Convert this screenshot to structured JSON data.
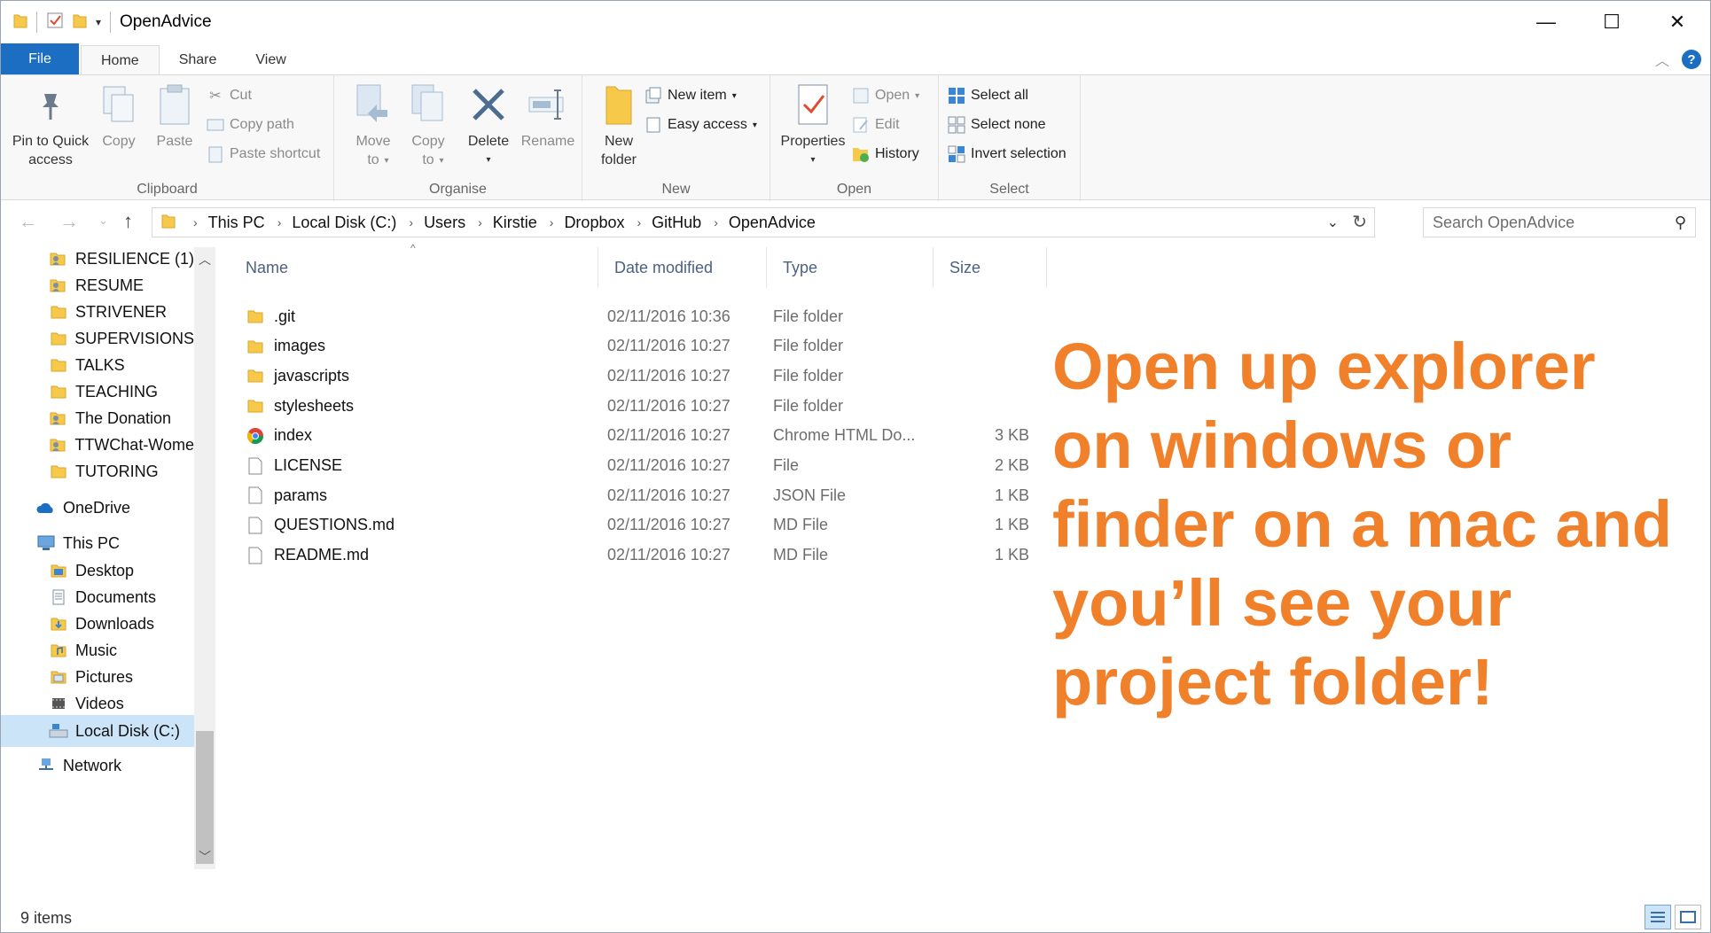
{
  "window": {
    "title": "OpenAdvice",
    "minimize": "—",
    "maximize": "☐",
    "close": "✕"
  },
  "tabs": [
    {
      "label": "File"
    },
    {
      "label": "Home"
    },
    {
      "label": "Share"
    },
    {
      "label": "View"
    }
  ],
  "ribbon": {
    "clipboard": {
      "label": "Clipboard",
      "pin": "Pin to Quick access",
      "copy": "Copy",
      "paste": "Paste",
      "cut": "Cut",
      "copy_path": "Copy path",
      "paste_shortcut": "Paste shortcut"
    },
    "organise": {
      "label": "Organise",
      "move_to": "Move to",
      "copy_to": "Copy to",
      "delete": "Delete",
      "rename": "Rename"
    },
    "new": {
      "label": "New",
      "new_folder": "New folder",
      "new_item": "New item",
      "easy_access": "Easy access"
    },
    "open": {
      "label": "Open",
      "properties": "Properties",
      "open": "Open",
      "edit": "Edit",
      "history": "History"
    },
    "select": {
      "label": "Select",
      "select_all": "Select all",
      "select_none": "Select none",
      "invert_selection": "Invert selection"
    }
  },
  "address": {
    "crumbs": [
      "This PC",
      "Local Disk (C:)",
      "Users",
      "Kirstie",
      "Dropbox",
      "GitHub",
      "OpenAdvice"
    ]
  },
  "search": {
    "placeholder": "Search OpenAdvice"
  },
  "nav_pane": {
    "items": [
      {
        "label": "RESILIENCE (1)",
        "icon": "shared-folder-icon"
      },
      {
        "label": "RESUME",
        "icon": "shared-folder-icon"
      },
      {
        "label": "STRIVENER",
        "icon": "folder-icon"
      },
      {
        "label": "SUPERVISIONS",
        "icon": "folder-icon"
      },
      {
        "label": "TALKS",
        "icon": "folder-icon"
      },
      {
        "label": "TEACHING",
        "icon": "folder-icon"
      },
      {
        "label": "The Donation",
        "icon": "shared-folder-icon"
      },
      {
        "label": "TTWChat-Wome",
        "icon": "shared-folder-icon"
      },
      {
        "label": "TUTORING",
        "icon": "folder-icon"
      },
      {
        "label": "OneDrive",
        "icon": "onedrive-icon"
      },
      {
        "label": "This PC",
        "icon": "this-pc-icon"
      },
      {
        "label": "Desktop",
        "icon": "desktop-folder-icon"
      },
      {
        "label": "Documents",
        "icon": "documents-folder-icon"
      },
      {
        "label": "Downloads",
        "icon": "downloads-folder-icon"
      },
      {
        "label": "Music",
        "icon": "music-folder-icon"
      },
      {
        "label": "Pictures",
        "icon": "pictures-folder-icon"
      },
      {
        "label": "Videos",
        "icon": "videos-folder-icon"
      },
      {
        "label": "Local Disk (C:)",
        "icon": "drive-icon"
      },
      {
        "label": "Network",
        "icon": "network-icon"
      }
    ]
  },
  "columns": {
    "name": "Name",
    "date": "Date modified",
    "type": "Type",
    "size": "Size"
  },
  "files": [
    {
      "name": ".git",
      "date": "02/11/2016 10:36",
      "type": "File folder",
      "size": "",
      "icon": "folder-icon"
    },
    {
      "name": "images",
      "date": "02/11/2016 10:27",
      "type": "File folder",
      "size": "",
      "icon": "folder-icon"
    },
    {
      "name": "javascripts",
      "date": "02/11/2016 10:27",
      "type": "File folder",
      "size": "",
      "icon": "folder-icon"
    },
    {
      "name": "stylesheets",
      "date": "02/11/2016 10:27",
      "type": "File folder",
      "size": "",
      "icon": "folder-icon"
    },
    {
      "name": "index",
      "date": "02/11/2016 10:27",
      "type": "Chrome HTML Do...",
      "size": "3 KB",
      "icon": "chrome-icon"
    },
    {
      "name": "LICENSE",
      "date": "02/11/2016 10:27",
      "type": "File",
      "size": "2 KB",
      "icon": "file-icon"
    },
    {
      "name": "params",
      "date": "02/11/2016 10:27",
      "type": "JSON File",
      "size": "1 KB",
      "icon": "file-icon"
    },
    {
      "name": "QUESTIONS.md",
      "date": "02/11/2016 10:27",
      "type": "MD File",
      "size": "1 KB",
      "icon": "file-icon"
    },
    {
      "name": "README.md",
      "date": "02/11/2016 10:27",
      "type": "MD File",
      "size": "1 KB",
      "icon": "file-icon"
    }
  ],
  "overlay": {
    "text": "Open up explorer on windows or finder on a mac and you’ll see your project folder!",
    "color": "#f0802a"
  },
  "status": {
    "items": "9 items"
  },
  "colors": {
    "accent": "#1b6ec2",
    "folder": "#f7c94b",
    "selection": "#cce4f7"
  }
}
